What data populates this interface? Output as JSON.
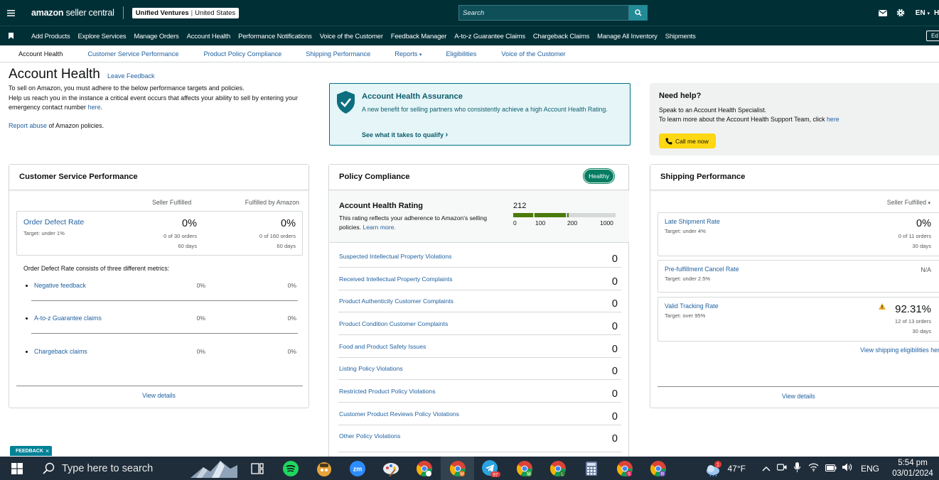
{
  "topbar": {
    "logo_bold": "amazon",
    "logo_rest": " seller central",
    "store_name": "Unified Ventures",
    "store_region": "United States",
    "search_placeholder": "Search",
    "language": "EN",
    "clipped_right": "H"
  },
  "nav": {
    "items": [
      "Add Products",
      "Explore Services",
      "Manage Orders",
      "Account Health",
      "Performance Notifications",
      "Voice of the Customer",
      "Feedback Manager",
      "A-to-z Guarantee Claims",
      "Chargeback Claims",
      "Manage All Inventory",
      "Shipments"
    ],
    "edit_label": "Ed"
  },
  "subnav": {
    "items": [
      "Account Health",
      "Customer Service Performance",
      "Product Policy Compliance",
      "Shipping Performance",
      "Reports",
      "Eligibilities",
      "Voice of the Customer"
    ]
  },
  "header": {
    "title": "Account Health",
    "leave_feedback": "Leave Feedback",
    "intro_1": "To sell on Amazon, you must adhere to the below performance targets and policies.",
    "intro_2": "Help us reach you in the instance a critical event occurs that affects your ability to sell by entering your emergency contact number",
    "intro_link": "here",
    "intro_end": ".",
    "report_link": "Report abuse",
    "report_rest": " of Amazon policies."
  },
  "assurance": {
    "title": "Account Health Assurance",
    "desc": "A new benefit for selling partners who consistently achieve a high Account Health Rating.",
    "link": "See what it takes to qualify"
  },
  "help": {
    "title": "Need help?",
    "line1": "Speak to an Account Health Specialist.",
    "line2": "To learn more about the Account Health Support Team, click",
    "line2_link": "here",
    "button": "Call me now"
  },
  "csp": {
    "title": "Customer Service Performance",
    "col_seller": "Seller Fulfilled",
    "col_fba": "Fulfilled by Amazon",
    "odr": {
      "name": "Order Defect Rate",
      "target": "Target: under 1%",
      "seller_value": "0%",
      "seller_orders": "0 of 30 orders",
      "seller_days": "60 days",
      "fba_value": "0%",
      "fba_orders": "0 of 160 orders",
      "fba_days": "60 days"
    },
    "consists": "Order Defect Rate consists of three different metrics:",
    "metrics": [
      {
        "name": "Negative feedback",
        "seller": "0%",
        "fba": "0%"
      },
      {
        "name": "A-to-z Guarantee claims",
        "seller": "0%",
        "fba": "0%"
      },
      {
        "name": "Chargeback claims",
        "seller": "0%",
        "fba": "0%"
      }
    ],
    "view_details": "View details"
  },
  "policy": {
    "title": "Policy Compliance",
    "badge": "Healthy",
    "ahr_title": "Account Health Rating",
    "ahr_desc": "This rating reflects your adherence to Amazon's selling policies.",
    "ahr_link": "Learn more.",
    "ahr_value": "212",
    "ahr_ticks": [
      "0",
      "100",
      "200",
      "1000"
    ],
    "violations": [
      {
        "name": "Suspected Intellectual Property Violations",
        "count": "0"
      },
      {
        "name": "Received Intellectual Property Complaints",
        "count": "0"
      },
      {
        "name": "Product Authenticity Customer Complaints",
        "count": "0"
      },
      {
        "name": "Product Condition Customer Complaints",
        "count": "0"
      },
      {
        "name": "Food and Product Safety Issues",
        "count": "0"
      },
      {
        "name": "Listing Policy Violations",
        "count": "0"
      },
      {
        "name": "Restricted Product Policy Violations",
        "count": "0"
      },
      {
        "name": "Customer Product Reviews Policy Violations",
        "count": "0"
      },
      {
        "name": "Other Policy Violations",
        "count": "0"
      }
    ]
  },
  "shipping": {
    "title": "Shipping Performance",
    "filter": "Seller Fulfilled",
    "late": {
      "name": "Late Shipment Rate",
      "target": "Target: under 4%",
      "value": "0%",
      "orders": "0 of 11 orders",
      "days": "30 days"
    },
    "cancel": {
      "name": "Pre-fulfillment Cancel Rate",
      "target": "Target: under 2.5%",
      "value": "N/A"
    },
    "vtr": {
      "name": "Valid Tracking Rate",
      "target": "Target: over 95%",
      "value": "92.31%",
      "orders": "12 of 13 orders",
      "days": "30 days"
    },
    "eligibilities": "View shipping eligibilities her",
    "view_details": "View details"
  },
  "feedback_tab": "FEEDBACK",
  "taskbar": {
    "search_placeholder": "Type here to search",
    "telegram_badge": "97",
    "weather_badge": "1",
    "temperature": "47°F",
    "language": "ENG",
    "time": "5:54 pm",
    "date": "03/01/2024",
    "chrome_profiles": [
      "",
      "M",
      "M",
      "L",
      "S",
      "R"
    ]
  },
  "colors": {
    "header_bg": "#002f36",
    "link": "#2162a1",
    "healthy": "#067d62",
    "rating_bar": "#4b7b0a"
  }
}
